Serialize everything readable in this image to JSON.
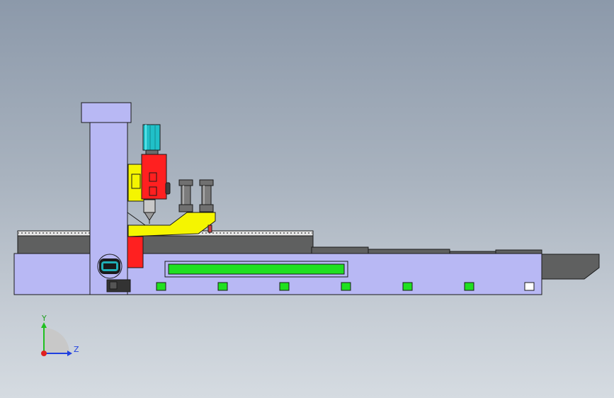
{
  "viewport": {
    "background_top": "#8c99aa",
    "background_bottom": "#d5dbe1"
  },
  "colors": {
    "frame": "#b8b8f4",
    "slab": "#5f6060",
    "spindle": "#ff2020",
    "carriage": "#f5f500",
    "motor": "#20c0c8",
    "indicator": "#20e020",
    "outline": "#1a1a1a"
  },
  "triad": {
    "y_label": "Y",
    "z_label": "Z",
    "y_color": "#20c020",
    "z_color": "#2040e0",
    "x_color": "#e02020"
  },
  "model": {
    "indicators": [
      "green-led",
      "green-led",
      "green-led",
      "green-led",
      "green-led",
      "green-led",
      "white-led"
    ]
  }
}
